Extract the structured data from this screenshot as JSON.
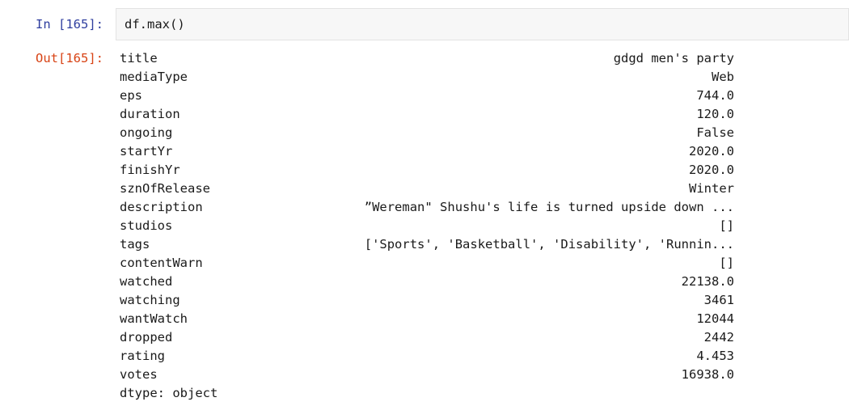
{
  "input_cell": {
    "prompt": "In [165]:",
    "code": "df.max()"
  },
  "output_cell": {
    "prompt": "Out[165]:",
    "rows": [
      {
        "label": "title",
        "value": "gdgd men's party"
      },
      {
        "label": "mediaType",
        "value": "Web"
      },
      {
        "label": "eps",
        "value": "744.0"
      },
      {
        "label": "duration",
        "value": "120.0"
      },
      {
        "label": "ongoing",
        "value": "False"
      },
      {
        "label": "startYr",
        "value": "2020.0"
      },
      {
        "label": "finishYr",
        "value": "2020.0"
      },
      {
        "label": "sznOfRelease",
        "value": "Winter"
      },
      {
        "label": "description",
        "value": "”Wereman\" Shushu's life is turned upside down ..."
      },
      {
        "label": "studios",
        "value": "[]"
      },
      {
        "label": "tags",
        "value": "['Sports', 'Basketball', 'Disability', 'Runnin..."
      },
      {
        "label": "contentWarn",
        "value": "[]"
      },
      {
        "label": "watched",
        "value": "22138.0"
      },
      {
        "label": "watching",
        "value": "3461"
      },
      {
        "label": "wantWatch",
        "value": "12044"
      },
      {
        "label": "dropped",
        "value": "2442"
      },
      {
        "label": "rating",
        "value": "4.453"
      },
      {
        "label": "votes",
        "value": "16938.0"
      }
    ],
    "dtype": "dtype: object"
  },
  "colors": {
    "in_prompt": "#303f9f",
    "out_prompt": "#d84315",
    "text": "#1a1a1a",
    "input_bg": "#f7f7f7",
    "input_border": "#e3e3e3"
  }
}
